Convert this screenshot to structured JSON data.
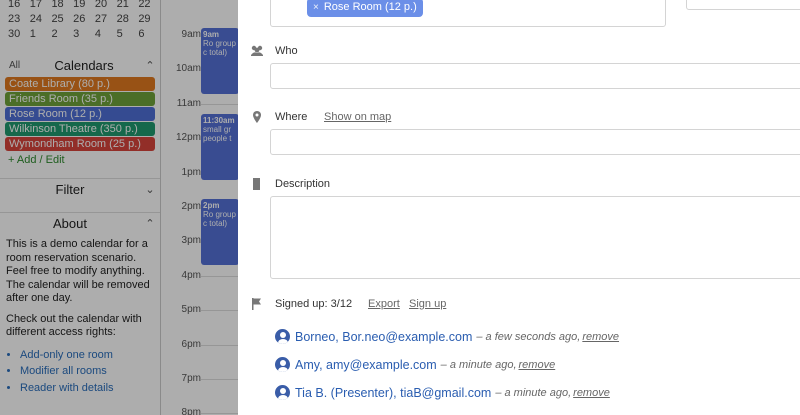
{
  "mini_calendar": {
    "rows": [
      [
        "16",
        "17",
        "18",
        "19",
        "20",
        "21",
        "22"
      ],
      [
        "23",
        "24",
        "25",
        "26",
        "27",
        "28",
        "29"
      ],
      [
        "30",
        "1",
        "2",
        "3",
        "4",
        "5",
        "6"
      ]
    ]
  },
  "calendars": {
    "all_label": "All",
    "title": "Calendars",
    "items": [
      {
        "label": "Coate Library (80 p.)",
        "color": "#e07a1f"
      },
      {
        "label": "Friends Room (35 p.)",
        "color": "#6fa33a"
      },
      {
        "label": "Rose Room (12 p.)",
        "color": "#4f6fd6"
      },
      {
        "label": "Wilkinson Theatre (350 p.)",
        "color": "#1f9a6f"
      },
      {
        "label": "Wymondham Room (25 p.)",
        "color": "#d8443c"
      }
    ],
    "add_edit": "Add / Edit"
  },
  "filter": {
    "title": "Filter"
  },
  "about": {
    "title": "About",
    "p1": "This is a demo calendar for a room reservation scenario. Feel free to modify anything. The calendar will be removed after one day.",
    "p2": "Check out the calendar with different access rights:",
    "links": [
      "Add-only one room",
      "Modifier all rooms",
      "Reader with details"
    ]
  },
  "timegrid": {
    "hours": [
      "9am",
      "10am",
      "11am",
      "12pm",
      "1pm",
      "2pm",
      "3pm",
      "4pm",
      "5pm",
      "6pm",
      "7pm",
      "8pm"
    ],
    "events": [
      {
        "time": "9am",
        "text": "Ro group c total)"
      },
      {
        "time": "11:30am",
        "text": "small gr people t"
      },
      {
        "time": "2pm",
        "text": "Ro group c total)"
      }
    ]
  },
  "dialog": {
    "resource_tag": "Rose Room (12 p.)",
    "tag_remove": "×",
    "who_label": "Who",
    "where_label": "Where",
    "show_on_map": "Show on map",
    "description_label": "Description",
    "signed_up": "Signed up: 3/12",
    "export": "Export",
    "sign_up": "Sign up",
    "signups": [
      {
        "name": "Borneo, Bor.neo@example.com",
        "when": "– a few seconds ago,",
        "remove": "remove"
      },
      {
        "name": "Amy, amy@example.com",
        "when": "– a minute ago,",
        "remove": "remove"
      },
      {
        "name": "Tia B. (Presenter), tiaB@gmail.com",
        "when": "– a minute ago,",
        "remove": "remove"
      }
    ]
  }
}
